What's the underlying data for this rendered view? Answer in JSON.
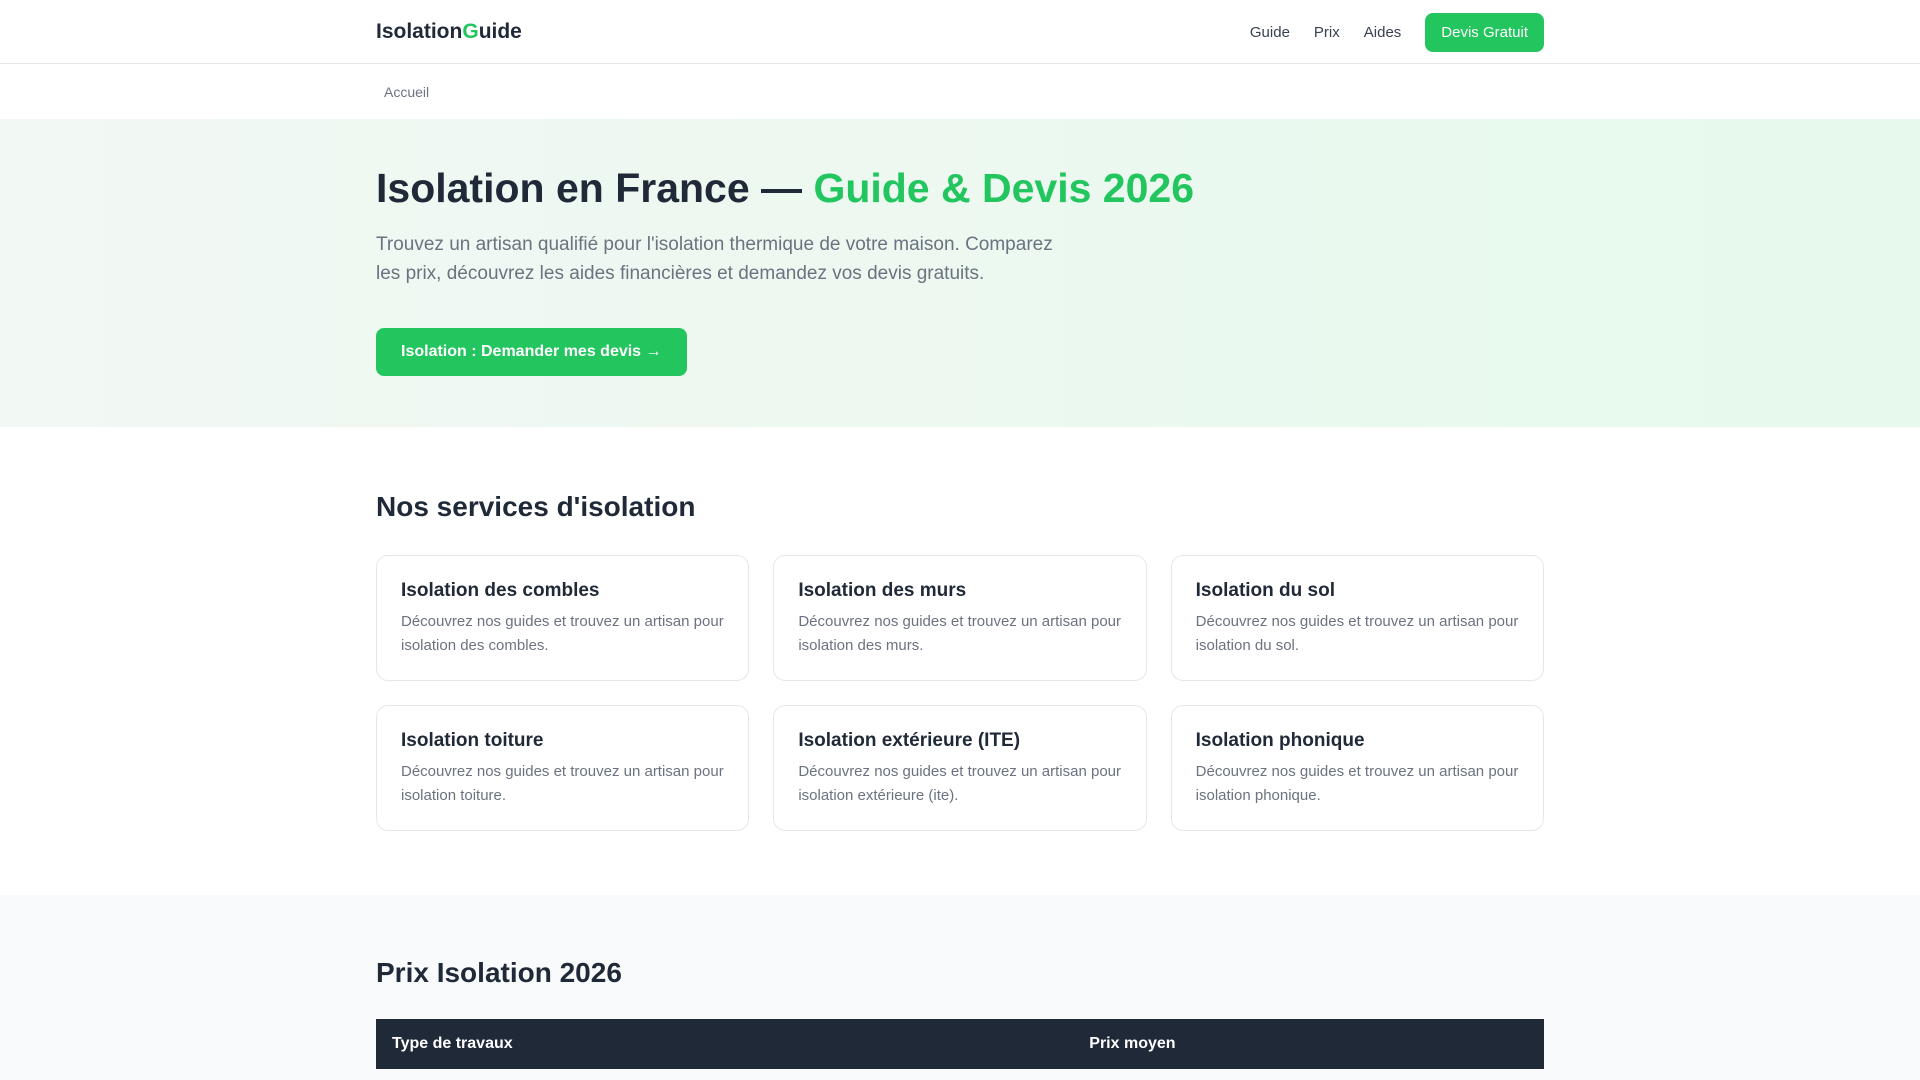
{
  "header": {
    "logo_part1": "Isolation",
    "logo_part2": "G",
    "logo_part3": "uide",
    "nav": [
      "Guide",
      "Prix",
      "Aides"
    ],
    "cta": "Devis Gratuit"
  },
  "breadcrumb": "Accueil",
  "hero": {
    "title": "Isolation en France — ",
    "title_accent": "Guide & Devis 2026",
    "subtitle": "Trouvez un artisan qualifié pour l'isolation thermique de votre maison. Comparez les prix, découvrez les aides financières et demandez vos devis gratuits.",
    "cta": "Isolation : Demander mes devis →"
  },
  "services": {
    "title": "Nos services d'isolation",
    "cards": [
      {
        "title": "Isolation des combles",
        "text": "Découvrez nos guides et trouvez un artisan pour isolation des combles."
      },
      {
        "title": "Isolation des murs",
        "text": "Découvrez nos guides et trouvez un artisan pour isolation des murs."
      },
      {
        "title": "Isolation du sol",
        "text": "Découvrez nos guides et trouvez un artisan pour isolation du sol."
      },
      {
        "title": "Isolation toiture",
        "text": "Découvrez nos guides et trouvez un artisan pour isolation toiture."
      },
      {
        "title": "Isolation extérieure (ITE)",
        "text": "Découvrez nos guides et trouvez un artisan pour isolation extérieure (ite)."
      },
      {
        "title": "Isolation phonique",
        "text": "Découvrez nos guides et trouvez un artisan pour isolation phonique."
      }
    ]
  },
  "prices": {
    "title": "Prix Isolation 2026",
    "columns": [
      "Type de travaux",
      "Prix moyen"
    ]
  }
}
